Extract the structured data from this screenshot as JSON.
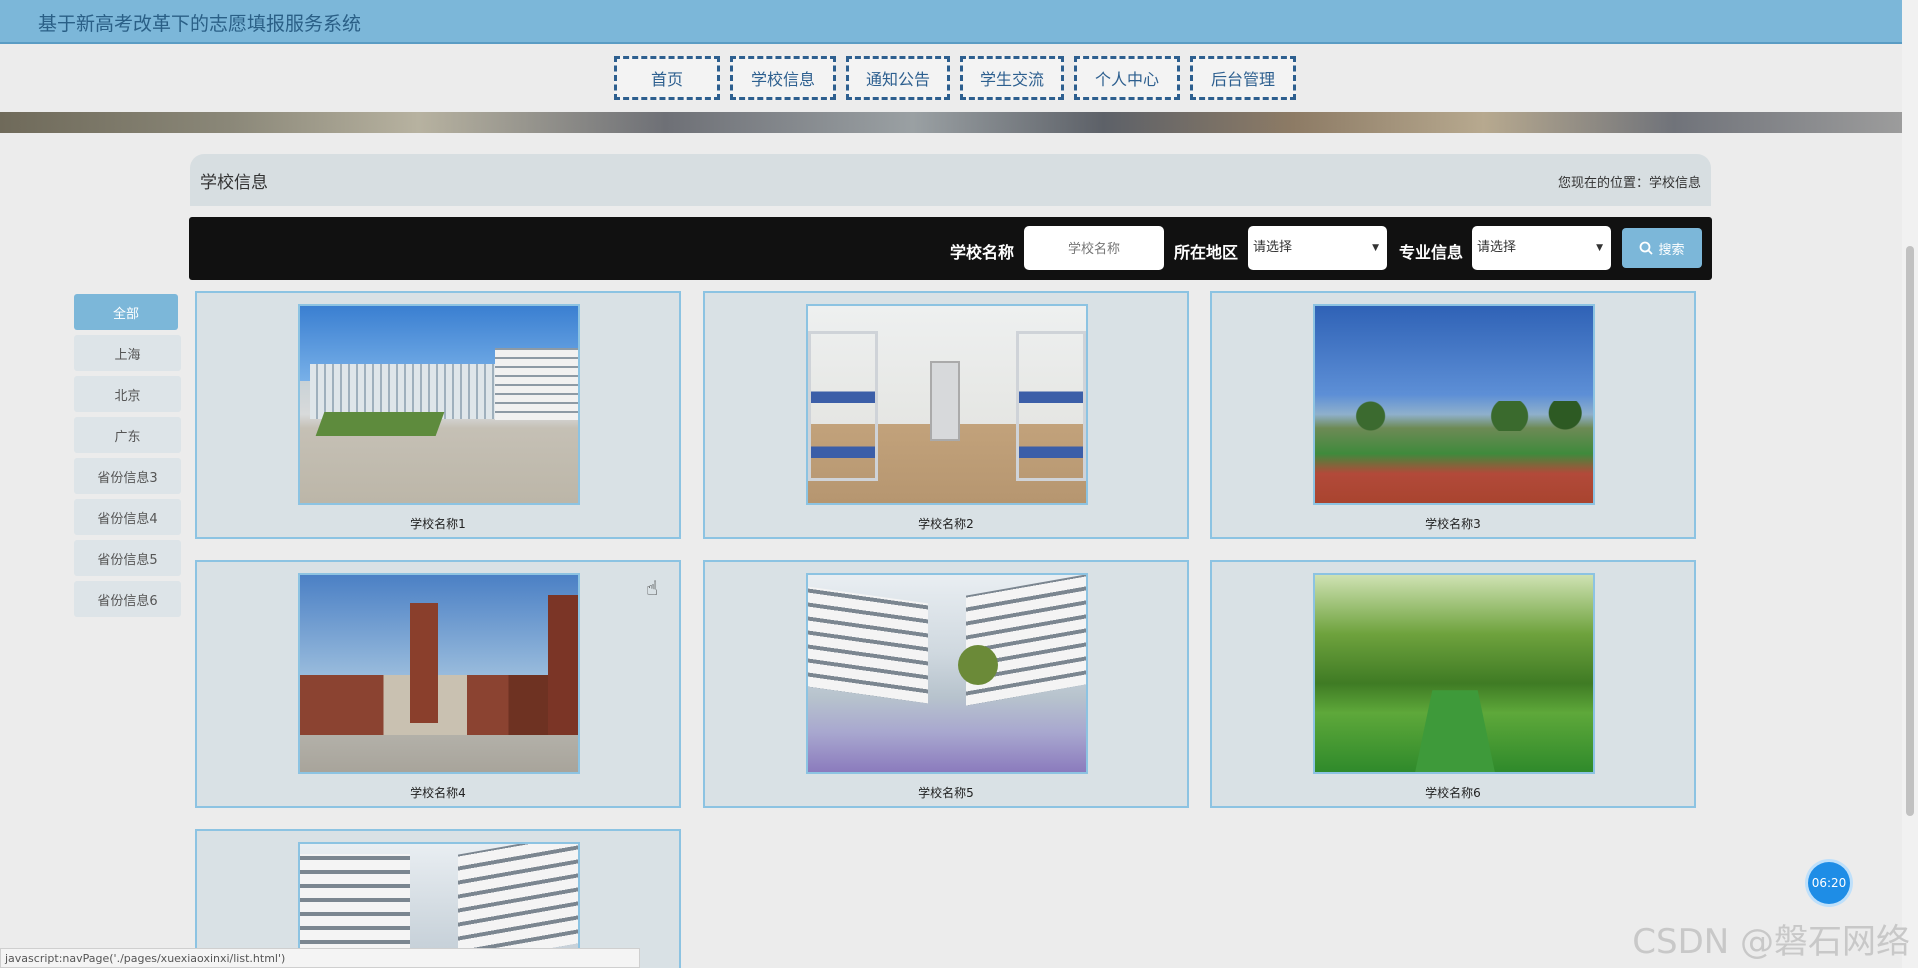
{
  "app": {
    "title": "基于新高考改革下的志愿填报服务系统"
  },
  "nav": [
    {
      "label": "首页"
    },
    {
      "label": "学校信息"
    },
    {
      "label": "通知公告"
    },
    {
      "label": "学生交流"
    },
    {
      "label": "个人中心"
    },
    {
      "label": "后台管理"
    }
  ],
  "section": {
    "title": "学校信息",
    "breadcrumb": "您现在的位置：学校信息"
  },
  "search": {
    "name_label": "学校名称",
    "name_placeholder": "学校名称",
    "region_label": "所在地区",
    "region_value": "请选择",
    "major_label": "专业信息",
    "major_value": "请选择",
    "button_label": "搜索"
  },
  "sidebar": {
    "items": [
      {
        "label": "全部",
        "active": true
      },
      {
        "label": "上海"
      },
      {
        "label": "北京"
      },
      {
        "label": "广东"
      },
      {
        "label": "省份信息3"
      },
      {
        "label": "省份信息4"
      },
      {
        "label": "省份信息5"
      },
      {
        "label": "省份信息6"
      }
    ]
  },
  "schools": [
    {
      "name": "学校名称1"
    },
    {
      "name": "学校名称2"
    },
    {
      "name": "学校名称3"
    },
    {
      "name": "学校名称4"
    },
    {
      "name": "学校名称5"
    },
    {
      "name": "学校名称6"
    },
    {
      "name": ""
    }
  ],
  "overlay": {
    "timer": "06:20",
    "watermark": "CSDN @磐石网络",
    "status_url": "javascript:navPage('./pages/xuexiaoxinxi/list.html')"
  },
  "colors": {
    "header": "#7cb7d9",
    "nav_border": "#2d5f8f",
    "search_bar": "#111111",
    "card_border": "#8cc3e2"
  }
}
